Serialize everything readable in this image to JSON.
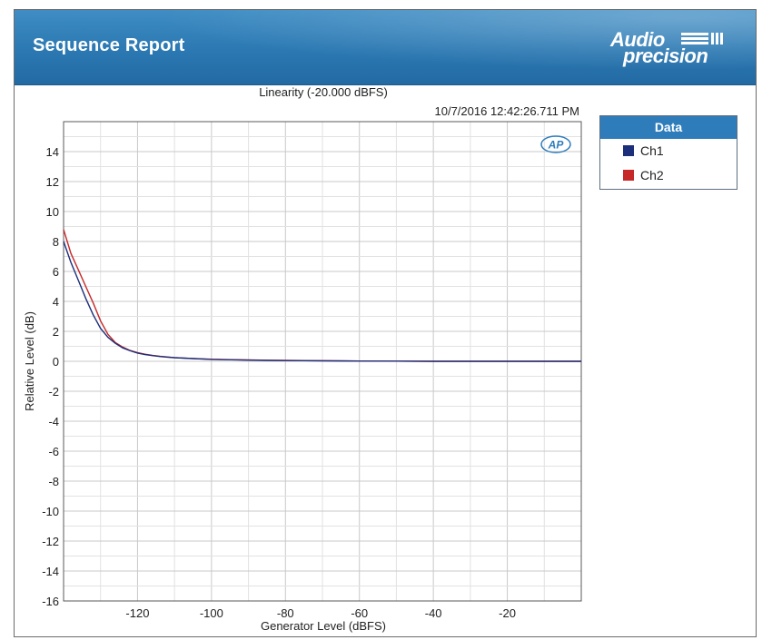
{
  "header": {
    "title": "Sequence Report",
    "brand_line1": "Audio",
    "brand_line2": "precision"
  },
  "chart_data": {
    "type": "line",
    "title": "Linearity (-20.000 dBFS)",
    "timestamp": "10/7/2016 12:42:26.711 PM",
    "xlabel": "Generator Level (dBFS)",
    "ylabel": "Relative Level (dB)",
    "xlim": [
      -140,
      0
    ],
    "ylim": [
      -16,
      16
    ],
    "xticks": [
      -120,
      -100,
      -80,
      -60,
      -40,
      -20
    ],
    "yticks": [
      14,
      12,
      10,
      8,
      6,
      4,
      2,
      0,
      -2,
      -4,
      -6,
      -8,
      -10,
      -12,
      -14,
      -16
    ],
    "grid": true,
    "watermark": "AP",
    "legend": {
      "title": "Data",
      "position": "right"
    },
    "series": [
      {
        "name": "Ch1",
        "color": "#1b2f7a",
        "points": [
          [
            -140,
            8.0
          ],
          [
            -138,
            6.6
          ],
          [
            -136,
            5.4
          ],
          [
            -134,
            4.2
          ],
          [
            -132,
            3.1
          ],
          [
            -130,
            2.2
          ],
          [
            -128,
            1.6
          ],
          [
            -126,
            1.2
          ],
          [
            -124,
            0.9
          ],
          [
            -122,
            0.7
          ],
          [
            -120,
            0.55
          ],
          [
            -118,
            0.45
          ],
          [
            -116,
            0.38
          ],
          [
            -114,
            0.32
          ],
          [
            -112,
            0.28
          ],
          [
            -110,
            0.24
          ],
          [
            -105,
            0.18
          ],
          [
            -100,
            0.13
          ],
          [
            -95,
            0.1
          ],
          [
            -90,
            0.08
          ],
          [
            -85,
            0.06
          ],
          [
            -80,
            0.05
          ],
          [
            -75,
            0.04
          ],
          [
            -70,
            0.03
          ],
          [
            -60,
            0.02
          ],
          [
            -50,
            0.01
          ],
          [
            -40,
            0.0
          ],
          [
            -20,
            0.0
          ],
          [
            0,
            0.0
          ]
        ]
      },
      {
        "name": "Ch2",
        "color": "#c62828",
        "points": [
          [
            -140,
            8.8
          ],
          [
            -138,
            7.2
          ],
          [
            -136,
            6.1
          ],
          [
            -134,
            5.0
          ],
          [
            -132,
            3.9
          ],
          [
            -130,
            2.7
          ],
          [
            -128,
            1.8
          ],
          [
            -126,
            1.25
          ],
          [
            -124,
            0.95
          ],
          [
            -122,
            0.72
          ],
          [
            -120,
            0.58
          ],
          [
            -118,
            0.47
          ],
          [
            -116,
            0.4
          ],
          [
            -114,
            0.34
          ],
          [
            -112,
            0.29
          ],
          [
            -110,
            0.25
          ],
          [
            -105,
            0.19
          ],
          [
            -100,
            0.14
          ],
          [
            -95,
            0.11
          ],
          [
            -90,
            0.09
          ],
          [
            -85,
            0.07
          ],
          [
            -80,
            0.06
          ],
          [
            -75,
            0.05
          ],
          [
            -70,
            0.04
          ],
          [
            -60,
            0.02
          ],
          [
            -50,
            0.01
          ],
          [
            -40,
            0.0
          ],
          [
            -20,
            0.0
          ],
          [
            0,
            0.0
          ]
        ]
      }
    ]
  }
}
